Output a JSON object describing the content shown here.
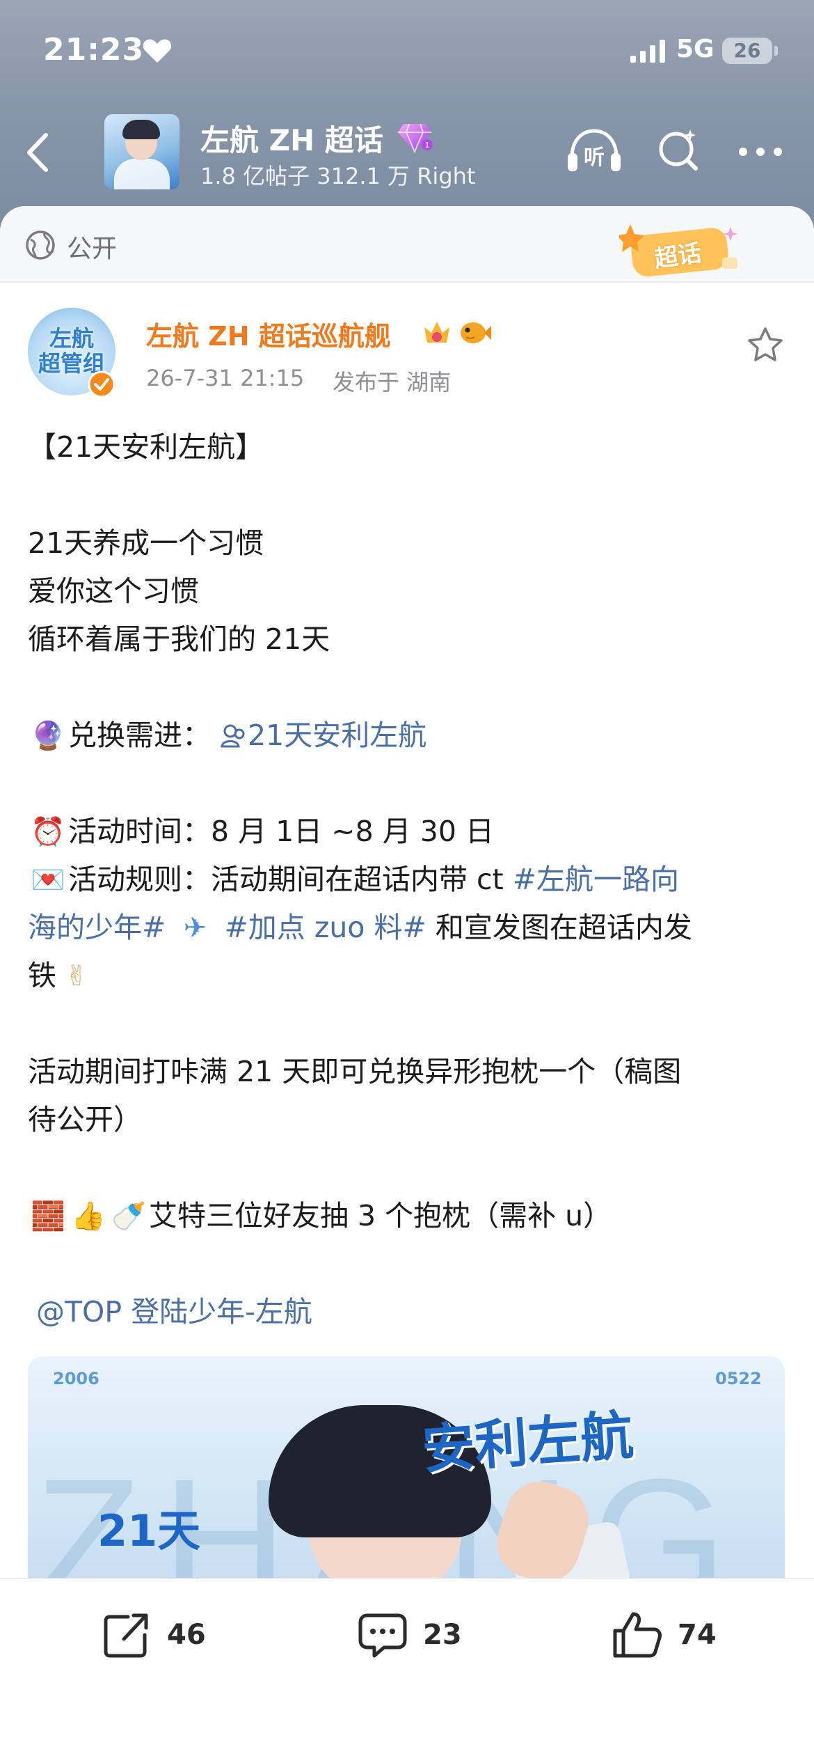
{
  "status_bar": {
    "time": "21:23",
    "network": "5G",
    "battery": "26"
  },
  "topic_header": {
    "title": "左航 ZH 超话",
    "stats": "1.8 亿帖子 312.1 万 Right",
    "icons": [
      "back-icon",
      "gem-icon",
      "listen-icon",
      "search-icon",
      "more-icon"
    ],
    "listen_label": "听"
  },
  "visibility": {
    "label": "公开",
    "sticker_label": "超话"
  },
  "author": {
    "avatar_text": "左航\n超管组",
    "name": "左航 ZH 超话巡航舰",
    "time": "26-7-31 21:15",
    "location": "发布于 湖南"
  },
  "post": {
    "title": "【21天安利左航】",
    "lines": [
      "21天养成一个习惯",
      "爱你这个习惯",
      "循环着属于我们的 21天"
    ],
    "exchange_prefix": "兑换需进：",
    "exchange_link": "21天安利左航",
    "time_prefix": "活动时间：",
    "time_value": "8 月 1日 ~8 月 30 日",
    "rule_prefix": "活动规则：活动期间在超话内带 ct ",
    "rule_tag1_a": "#左航一路向",
    "rule_tag1_b": "海的少年#",
    "rule_tag2": "#加点 zuo 料#",
    "rule_suffix_a": " 和宣发图在超话内发",
    "rule_suffix_b": "铁",
    "reward_a": "活动期间打咔满 21 天即可兑换异形抱枕一个（稿图",
    "reward_b": "待公开）",
    "lottery": "艾特三位好友抽 3 个抱枕（需补 u）",
    "mention": "@TOP 登陆少年-左航",
    "emojis": {
      "exchange": "🔮",
      "time": "⏰",
      "rule": "💌",
      "plane": "✈",
      "victory": "✌",
      "brick": "🧱",
      "thumb": "👍",
      "bottle": "🍼"
    }
  },
  "banner": {
    "year": "2006",
    "date": "0522",
    "days": "21天",
    "headline": "安利左航",
    "bg_letters": "ZHANG"
  },
  "actions": {
    "repost_count": "46",
    "comment_count": "23",
    "like_count": "74"
  }
}
